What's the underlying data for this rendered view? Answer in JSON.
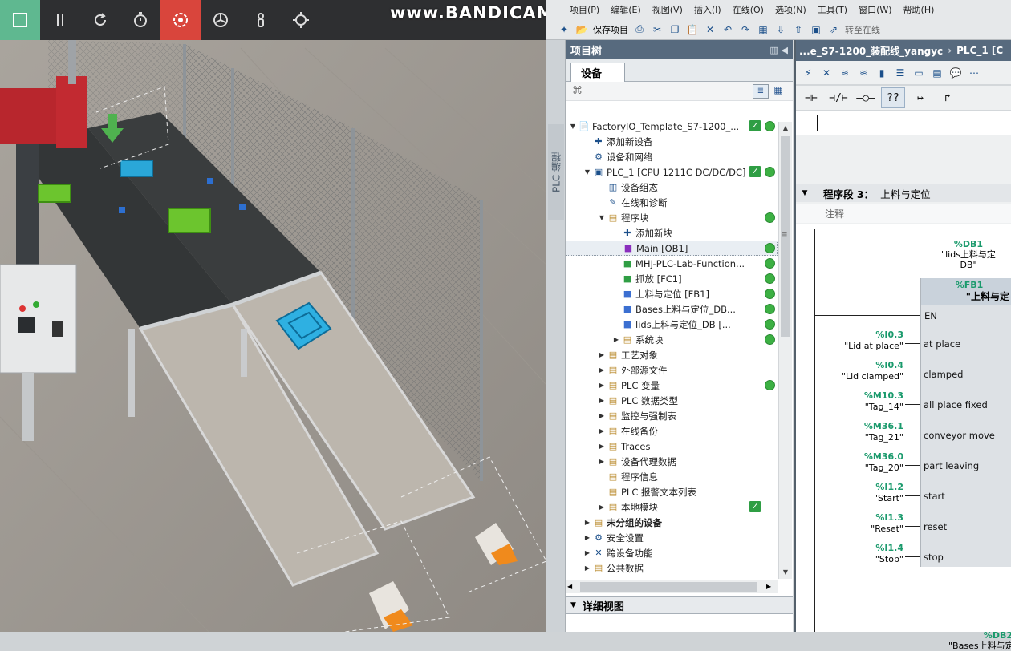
{
  "watermark": "www.BANDICAM.com",
  "factoryio": {
    "toolbar": [
      "stop-square",
      "pause",
      "reset",
      "timer",
      "camera-record",
      "fan",
      "person",
      "locate"
    ]
  },
  "menubar": [
    "项目(P)",
    "编辑(E)",
    "视图(V)",
    "插入(I)",
    "在线(O)",
    "选项(N)",
    "工具(T)",
    "窗口(W)",
    "帮助(H)"
  ],
  "toolbar": {
    "save_label": "保存项目",
    "goto_online": "转至在线"
  },
  "side_tab": "PLC 编程",
  "project_tree": {
    "title": "项目树",
    "tab": "设备",
    "items": [
      {
        "label": "FactoryIO_Template_S7-1200_...",
        "level": 0,
        "arrow": "▼",
        "icon": "📄",
        "check": true,
        "dot": true
      },
      {
        "label": "添加新设备",
        "level": 1,
        "arrow": "",
        "icon": "✚",
        "check": false,
        "dot": false
      },
      {
        "label": "设备和网络",
        "level": 1,
        "arrow": "",
        "icon": "⚙",
        "check": false,
        "dot": false
      },
      {
        "label": "PLC_1 [CPU 1211C DC/DC/DC]",
        "level": 1,
        "arrow": "▼",
        "icon": "▣",
        "check": true,
        "dot": true
      },
      {
        "label": "设备组态",
        "level": 2,
        "arrow": "",
        "icon": "▥",
        "check": false,
        "dot": false
      },
      {
        "label": "在线和诊断",
        "level": 2,
        "arrow": "",
        "icon": "✎",
        "check": false,
        "dot": false
      },
      {
        "label": "程序块",
        "level": 2,
        "arrow": "▼",
        "icon": "▤",
        "check": false,
        "dot": true
      },
      {
        "label": "添加新块",
        "level": 3,
        "arrow": "",
        "icon": "✚",
        "check": false,
        "dot": false
      },
      {
        "label": "Main [OB1]",
        "level": 3,
        "arrow": "",
        "icon": "■",
        "check": false,
        "dot": true,
        "selected": true
      },
      {
        "label": "MHJ-PLC-Lab-Function...",
        "level": 3,
        "arrow": "",
        "icon": "■",
        "check": false,
        "dot": true
      },
      {
        "label": "抓放 [FC1]",
        "level": 3,
        "arrow": "",
        "icon": "■",
        "check": false,
        "dot": true
      },
      {
        "label": "上料与定位 [FB1]",
        "level": 3,
        "arrow": "",
        "icon": "■",
        "check": false,
        "dot": true
      },
      {
        "label": "Bases上料与定位_DB...",
        "level": 3,
        "arrow": "",
        "icon": "■",
        "check": false,
        "dot": true
      },
      {
        "label": "lids上料与定位_DB [...",
        "level": 3,
        "arrow": "",
        "icon": "■",
        "check": false,
        "dot": true
      },
      {
        "label": "系统块",
        "level": 3,
        "arrow": "▶",
        "icon": "▤",
        "check": false,
        "dot": true
      },
      {
        "label": "工艺对象",
        "level": 2,
        "arrow": "▶",
        "icon": "▤",
        "check": false,
        "dot": false
      },
      {
        "label": "外部源文件",
        "level": 2,
        "arrow": "▶",
        "icon": "▤",
        "check": false,
        "dot": false
      },
      {
        "label": "PLC 变量",
        "level": 2,
        "arrow": "▶",
        "icon": "▤",
        "check": false,
        "dot": true
      },
      {
        "label": "PLC 数据类型",
        "level": 2,
        "arrow": "▶",
        "icon": "▤",
        "check": false,
        "dot": false
      },
      {
        "label": "监控与强制表",
        "level": 2,
        "arrow": "▶",
        "icon": "▤",
        "check": false,
        "dot": false
      },
      {
        "label": "在线备份",
        "level": 2,
        "arrow": "▶",
        "icon": "▤",
        "check": false,
        "dot": false
      },
      {
        "label": "Traces",
        "level": 2,
        "arrow": "▶",
        "icon": "▤",
        "check": false,
        "dot": false
      },
      {
        "label": "设备代理数据",
        "level": 2,
        "arrow": "▶",
        "icon": "▤",
        "check": false,
        "dot": false
      },
      {
        "label": "程序信息",
        "level": 2,
        "arrow": "",
        "icon": "▤",
        "check": false,
        "dot": false
      },
      {
        "label": "PLC 报警文本列表",
        "level": 2,
        "arrow": "",
        "icon": "▤",
        "check": false,
        "dot": false
      },
      {
        "label": "本地模块",
        "level": 2,
        "arrow": "▶",
        "icon": "▤",
        "check": true,
        "dot": false
      },
      {
        "label": "未分组的设备",
        "level": 1,
        "arrow": "▶",
        "icon": "▤",
        "check": false,
        "dot": false,
        "bold": true
      },
      {
        "label": "安全设置",
        "level": 1,
        "arrow": "▶",
        "icon": "⚙",
        "check": false,
        "dot": false
      },
      {
        "label": "跨设备功能",
        "level": 1,
        "arrow": "▶",
        "icon": "✕",
        "check": false,
        "dot": false
      },
      {
        "label": "公共数据",
        "level": 1,
        "arrow": "▶",
        "icon": "▤",
        "check": false,
        "dot": false
      }
    ],
    "detail_view": "详细视图"
  },
  "editor": {
    "breadcrumb_left": "...e_S7-1200_装配线_yangyc",
    "breadcrumb_right": "PLC_1 [C",
    "ladder_buttons": [
      "⊣⊢",
      "⊣/⊢",
      "–○–",
      "??",
      "↦",
      "↱"
    ],
    "segment_label": "程序段 3：",
    "segment_title": "上料与定位",
    "comment": "注释",
    "db1_addr": "%DB1",
    "db1_name": "\"lids上料与定",
    "db1_suffix": "DB\"",
    "fb_addr": "%FB1",
    "fb_name": "\"上料与定",
    "en": "EN",
    "params": [
      {
        "addr": "%I0.3",
        "tag": "\"Lid at place\"",
        "pin": "at place"
      },
      {
        "addr": "%I0.4",
        "tag": "\"Lid clamped\"",
        "pin": "clamped"
      },
      {
        "addr": "%M10.3",
        "tag": "\"Tag_14\"",
        "pin": "all place fixed"
      },
      {
        "addr": "%M36.1",
        "tag": "\"Tag_21\"",
        "pin": "conveyor move"
      },
      {
        "addr": "%M36.0",
        "tag": "\"Tag_20\"",
        "pin": "part leaving"
      },
      {
        "addr": "%I1.2",
        "tag": "\"Start\"",
        "pin": "start"
      },
      {
        "addr": "%I1.3",
        "tag": "\"Reset\"",
        "pin": "reset"
      },
      {
        "addr": "%I1.4",
        "tag": "\"Stop\"",
        "pin": "stop"
      }
    ],
    "db2_addr": "%DB2",
    "db2_name": "\"Bases上料与定"
  },
  "colors": {
    "accent": "#576a7e",
    "ok": "#2f9e44",
    "tag_green": "#1a9a6c",
    "fio_green": "#5fb890",
    "fio_red": "#d9453c"
  }
}
